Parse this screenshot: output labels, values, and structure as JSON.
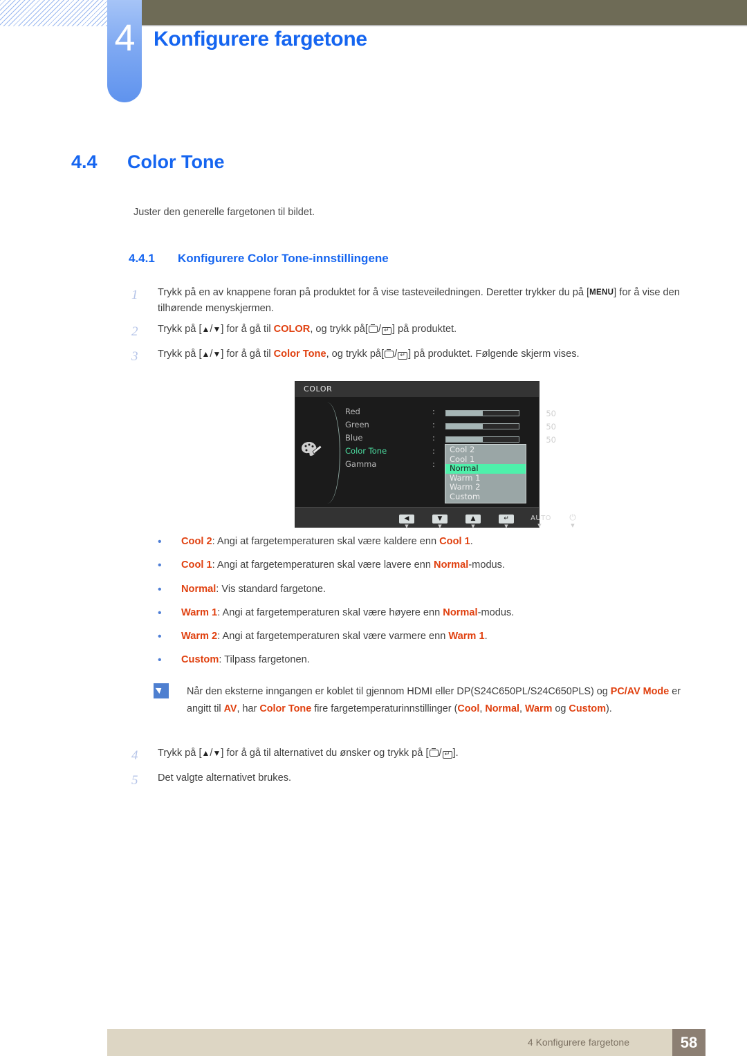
{
  "chapter": {
    "number": "4",
    "title": "Konfigurere fargetone"
  },
  "section": {
    "number": "4.4",
    "title": "Color Tone",
    "intro": "Juster den generelle fargetonen til bildet.",
    "sub_number": "4.4.1",
    "sub_title": "Konfigurere Color Tone-innstillingene"
  },
  "steps": [
    {
      "n": "1",
      "parts": [
        {
          "t": "Trykk på en av knappene foran på produktet for å vise tasteveiledningen. Deretter trykker du på ["
        },
        {
          "t": "MENU",
          "style": "menukey"
        },
        {
          "t": "] for å vise den tilhørende menyskjermen."
        }
      ]
    },
    {
      "n": "2",
      "parts": [
        {
          "t": "Trykk på ["
        },
        {
          "t": "▲",
          "style": "tri"
        },
        {
          "t": "/"
        },
        {
          "t": "▼",
          "style": "tri"
        },
        {
          "t": "] for å gå til "
        },
        {
          "t": "COLOR",
          "style": "kw"
        },
        {
          "t": ", og trykk på["
        },
        {
          "t": "icon-box",
          "style": "ico-box"
        },
        {
          "t": "/"
        },
        {
          "t": "icon-enter",
          "style": "ico-enter"
        },
        {
          "t": "] på produktet."
        }
      ]
    },
    {
      "n": "3",
      "parts": [
        {
          "t": "Trykk på ["
        },
        {
          "t": "▲",
          "style": "tri"
        },
        {
          "t": "/"
        },
        {
          "t": "▼",
          "style": "tri"
        },
        {
          "t": "] for å gå til "
        },
        {
          "t": "Color Tone",
          "style": "kw"
        },
        {
          "t": ", og trykk på["
        },
        {
          "t": "icon-box",
          "style": "ico-box"
        },
        {
          "t": "/"
        },
        {
          "t": "icon-enter",
          "style": "ico-enter"
        },
        {
          "t": "] på produktet. Følgende skjerm vises."
        }
      ]
    }
  ],
  "steps_after": [
    {
      "n": "4",
      "parts": [
        {
          "t": "Trykk på ["
        },
        {
          "t": "▲",
          "style": "tri"
        },
        {
          "t": "/"
        },
        {
          "t": "▼",
          "style": "tri"
        },
        {
          "t": "] for å gå til alternativet du ønsker og trykk på ["
        },
        {
          "t": "icon-box",
          "style": "ico-box"
        },
        {
          "t": "/"
        },
        {
          "t": "icon-enter",
          "style": "ico-enter"
        },
        {
          "t": "]."
        }
      ]
    },
    {
      "n": "5",
      "parts": [
        {
          "t": "Det valgte alternativet brukes."
        }
      ]
    }
  ],
  "osd": {
    "title": "COLOR",
    "icon": "palette-icon",
    "rows": [
      {
        "label": "Red",
        "colon": ":",
        "value": "50",
        "fill_pct": 50
      },
      {
        "label": "Green",
        "colon": ":",
        "value": "50",
        "fill_pct": 50
      },
      {
        "label": "Blue",
        "colon": ":",
        "value": "50",
        "fill_pct": 50
      },
      {
        "label": "Color Tone",
        "colon": ":",
        "selected": true
      },
      {
        "label": "Gamma",
        "colon": ":"
      }
    ],
    "dropdown": {
      "items": [
        "Cool 2",
        "Cool 1",
        "Normal",
        "Warm 1",
        "Warm 2",
        "Custom"
      ],
      "active": "Normal"
    },
    "buttons": [
      {
        "name": "left-arrow-button",
        "glyph": "◀"
      },
      {
        "name": "down-arrow-button",
        "glyph": "▼"
      },
      {
        "name": "up-arrow-button",
        "glyph": "▲"
      },
      {
        "name": "enter-button",
        "glyph": "↵"
      },
      {
        "name": "auto-button",
        "glyph": "AUTO"
      },
      {
        "name": "power-button",
        "glyph": "⏻"
      }
    ]
  },
  "bullets": [
    {
      "dot": "•",
      "parts": [
        {
          "t": "Cool 2",
          "style": "kw"
        },
        {
          "t": ": Angi at fargetemperaturen skal være kaldere enn "
        },
        {
          "t": "Cool 1",
          "style": "kw"
        },
        {
          "t": "."
        }
      ]
    },
    {
      "dot": "•",
      "parts": [
        {
          "t": "Cool 1",
          "style": "kw"
        },
        {
          "t": ": Angi at fargetemperaturen skal være lavere enn "
        },
        {
          "t": "Normal",
          "style": "kw"
        },
        {
          "t": "-modus."
        }
      ]
    },
    {
      "dot": "•",
      "parts": [
        {
          "t": "Normal",
          "style": "kw"
        },
        {
          "t": ": Vis standard fargetone."
        }
      ]
    },
    {
      "dot": "•",
      "parts": [
        {
          "t": "Warm 1",
          "style": "kw"
        },
        {
          "t": ": Angi at fargetemperaturen skal være høyere enn "
        },
        {
          "t": "Normal",
          "style": "kw"
        },
        {
          "t": "-modus."
        }
      ]
    },
    {
      "dot": "•",
      "parts": [
        {
          "t": "Warm 2",
          "style": "kw"
        },
        {
          "t": ": Angi at fargetemperaturen skal være varmere enn "
        },
        {
          "t": "Warm 1",
          "style": "kw"
        },
        {
          "t": "."
        }
      ]
    },
    {
      "dot": "•",
      "parts": [
        {
          "t": "Custom",
          "style": "kw"
        },
        {
          "t": ": Tilpass fargetonen."
        }
      ]
    }
  ],
  "note": {
    "icon": "note-pencil-icon",
    "parts": [
      {
        "t": "Når den eksterne inngangen er koblet til gjennom HDMI eller DP(S24C650PL/S24C650PLS) og "
      },
      {
        "t": "PC/AV Mode",
        "style": "kw"
      },
      {
        "t": " er angitt til "
      },
      {
        "t": "AV",
        "style": "kw"
      },
      {
        "t": ", har "
      },
      {
        "t": "Color Tone",
        "style": "kw"
      },
      {
        "t": " fire fargetemperaturinnstillinger ("
      },
      {
        "t": "Cool",
        "style": "kw"
      },
      {
        "t": ", "
      },
      {
        "t": "Normal",
        "style": "kw"
      },
      {
        "t": ", "
      },
      {
        "t": "Warm",
        "style": "kw"
      },
      {
        "t": " og "
      },
      {
        "t": "Custom",
        "style": "kw"
      },
      {
        "t": ")."
      }
    ]
  },
  "footer": {
    "text": "4 Konfigurere fargetone",
    "page": "58"
  },
  "colors": {
    "heading_blue": "#1565f0",
    "keyword_orange": "#e0400f",
    "header_bar": "#6e6b56",
    "tab_blue": "#7fa9f2",
    "footer_bar": "#ddd6c4",
    "footer_page": "#8c7f73",
    "osd_highlight": "#4ff0ab"
  }
}
